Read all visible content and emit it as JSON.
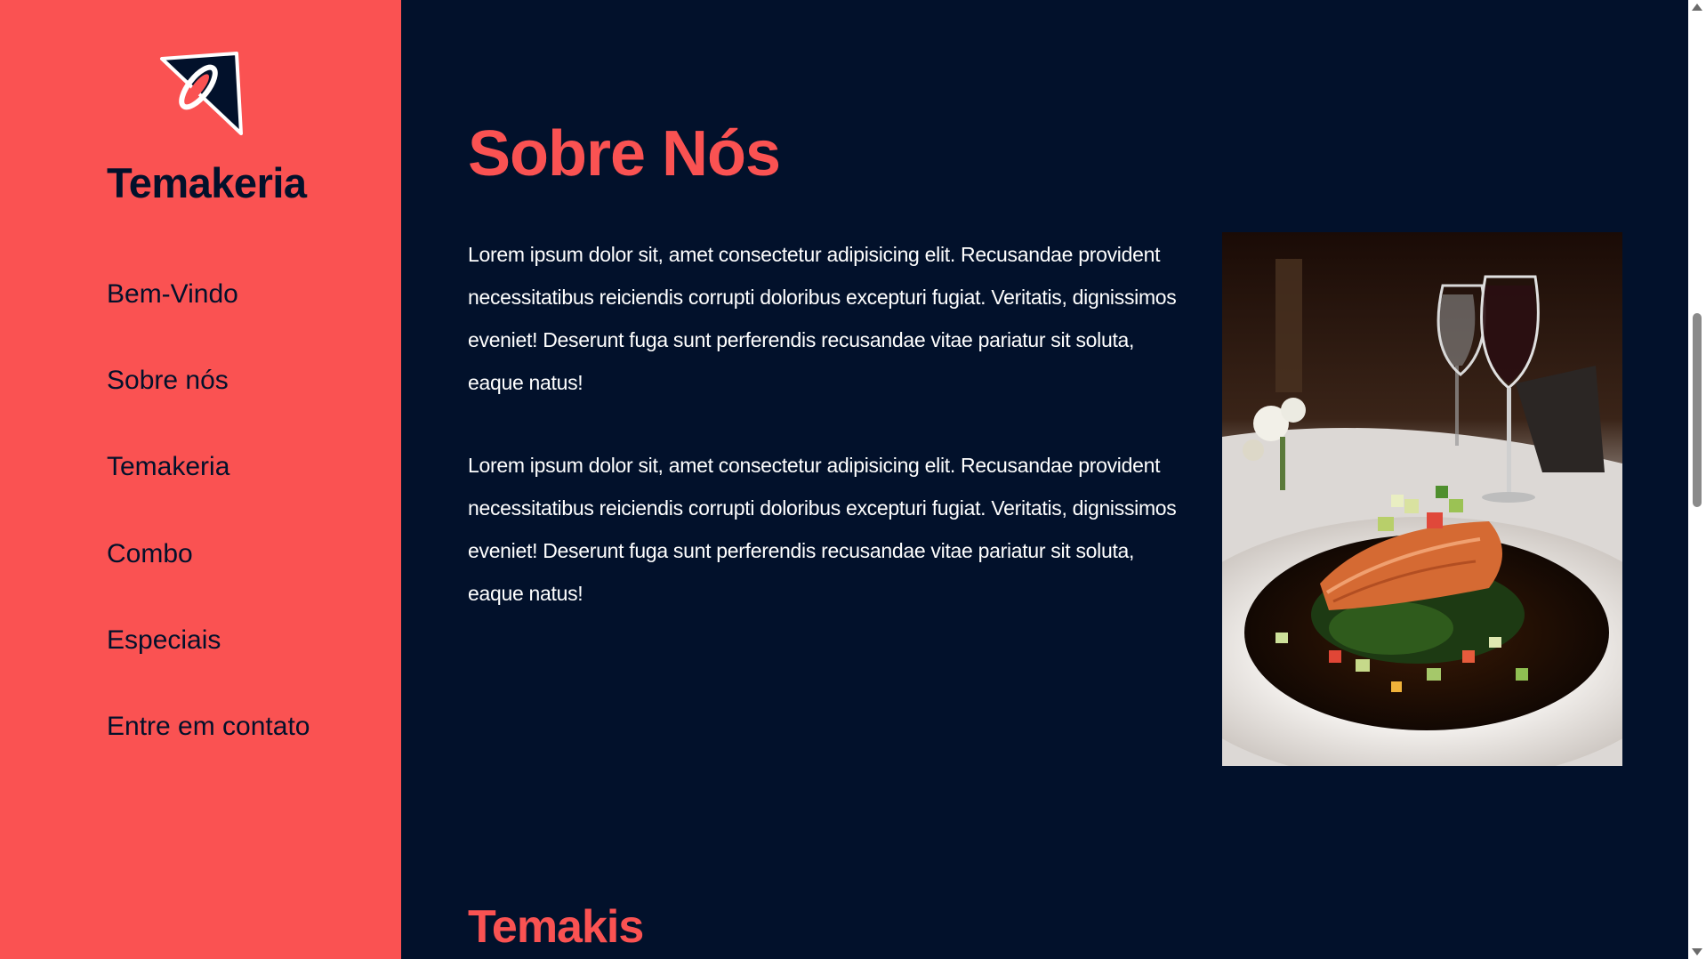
{
  "sidebar": {
    "brand": "Temakeria",
    "logo_icon": "temakeria-logo-icon",
    "items": [
      {
        "label": "Bem-Vindo"
      },
      {
        "label": "Sobre nós"
      },
      {
        "label": "Temakeria"
      },
      {
        "label": "Combo"
      },
      {
        "label": "Especiais"
      },
      {
        "label": "Entre em contato"
      }
    ]
  },
  "main": {
    "section_title": "Sobre Nós",
    "paragraphs": [
      "Lorem ipsum dolor sit, amet consectetur adipisicing elit. Recusandae provident necessitatibus reiciendis corrupti doloribus excepturi fugiat. Veritatis, dignissimos eveniet! Deserunt fuga sunt perferendis recusandae vitae pariatur sit soluta, eaque natus!",
      "Lorem ipsum dolor sit, amet consectetur adipisicing elit. Recusandae provident necessitatibus reiciendis corrupti doloribus excepturi fugiat. Veritatis, dignissimos eveniet! Deserunt fuga sunt perferendis recusandae vitae pariatur sit soluta, eaque natus!"
    ],
    "photo_icon": "salmon-dish-photo",
    "next_section_title": "Temakis"
  },
  "colors": {
    "accent": "#fa5252",
    "background": "#02112b",
    "text": "#ffffff"
  }
}
